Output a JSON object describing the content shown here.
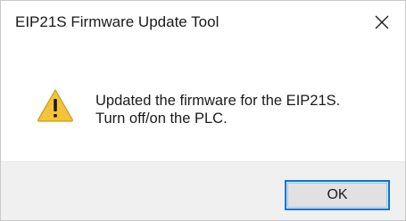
{
  "dialog": {
    "title": "EIP21S Firmware Update Tool",
    "close_icon": "close-icon",
    "icon": "warning-icon",
    "message_lines": [
      "Updated the firmware for the EIP21S.",
      "Turn off/on the PLC."
    ],
    "ok_label": "OK"
  },
  "colors": {
    "accent_border": "#0078d7",
    "warning_fill": "#f3c33a",
    "footer_bg": "#f0f0f0"
  }
}
